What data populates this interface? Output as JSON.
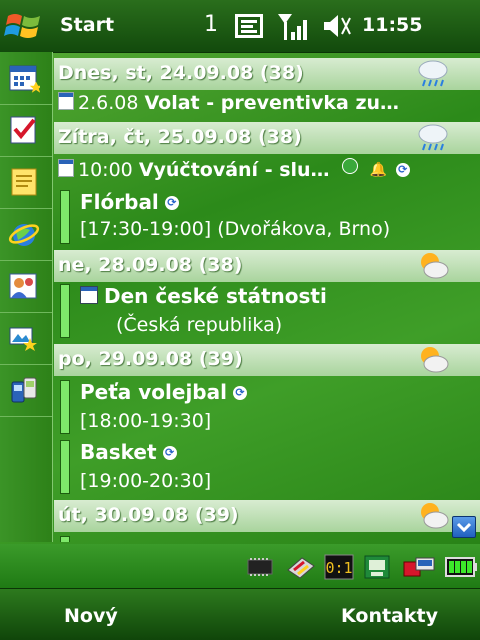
{
  "topbar": {
    "start_label": "Start",
    "notification_count": "1",
    "clock": "11:55"
  },
  "sidebar": {
    "items": [
      {
        "icon": "calendar-icon"
      },
      {
        "icon": "tasks-icon"
      },
      {
        "icon": "notes-icon"
      },
      {
        "icon": "internet-explorer-icon"
      },
      {
        "icon": "contacts-icon"
      },
      {
        "icon": "pictures-icon"
      },
      {
        "icon": "messaging-icon"
      }
    ]
  },
  "agenda": {
    "days": [
      {
        "header": "Dnes, st, 24.09.08 (38)",
        "weather": "rain-cloud-icon",
        "events": [
          {
            "kind": "task",
            "date": "2.6.08",
            "title": "Volat - preventivka zu…"
          }
        ]
      },
      {
        "header": "Zítra, čt, 25.09.08 (38)",
        "weather": "rain-cloud-icon",
        "events": [
          {
            "kind": "task",
            "time": "10:00",
            "title": "Vyúčtování - slu…"
          },
          {
            "kind": "appointment",
            "title": "Flórbal",
            "detail": "[17:30-19:00] (Dvořákova, Brno)"
          }
        ]
      },
      {
        "header": "ne, 28.09.08 (38)",
        "weather": "partly-sunny-icon",
        "events": [
          {
            "kind": "allday",
            "title": "Den české státnosti",
            "detail": "(Česká republika)"
          }
        ]
      },
      {
        "header": "po, 29.09.08 (39)",
        "weather": "partly-sunny-icon",
        "events": [
          {
            "kind": "appointment",
            "title": "Peťa volejbal",
            "detail": "[18:00-19:30]"
          },
          {
            "kind": "appointment",
            "title": "Basket",
            "detail": "[19:00-20:30]"
          }
        ]
      },
      {
        "header": "út, 30.09.08 (39)",
        "weather": "partly-sunny-icon",
        "events": []
      }
    ]
  },
  "softkeys": {
    "left": "Nový",
    "right": "Kontakty"
  },
  "colors": {
    "background": "#2f8a18",
    "header_band": "#b5dba8",
    "event_bar": "#7ee86a"
  }
}
